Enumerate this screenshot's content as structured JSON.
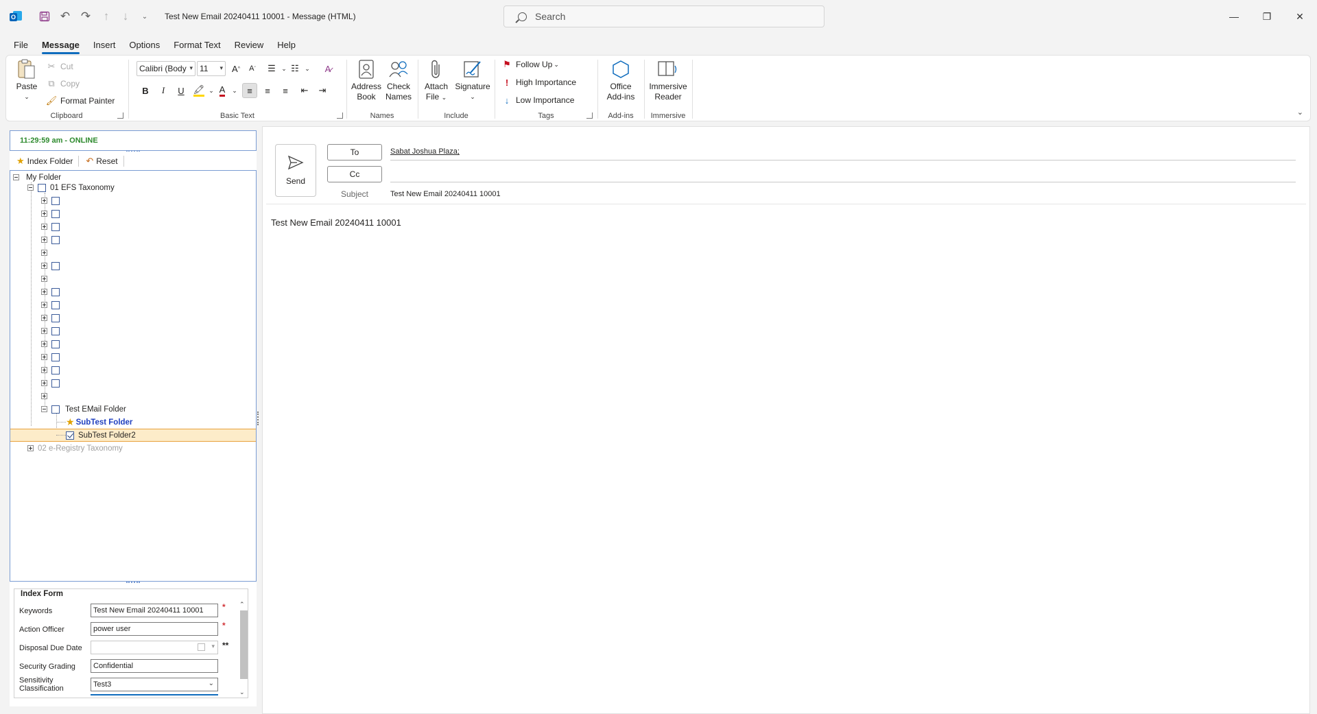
{
  "window": {
    "title": "Test New Email  20240411 10001  -  Message (HTML)",
    "search_placeholder": "Search"
  },
  "menu": {
    "tabs": [
      "File",
      "Message",
      "Insert",
      "Options",
      "Format Text",
      "Review",
      "Help"
    ],
    "active": "Message"
  },
  "ribbon": {
    "clipboard": {
      "paste": "Paste",
      "cut": "Cut",
      "copy": "Copy",
      "format_painter": "Format Painter",
      "label": "Clipboard"
    },
    "basic_text": {
      "font": "Calibri (Body",
      "size": "11",
      "label": "Basic Text"
    },
    "names": {
      "address_book_1": "Address",
      "address_book_2": "Book",
      "check_names_1": "Check",
      "check_names_2": "Names",
      "label": "Names"
    },
    "include": {
      "attach_1": "Attach",
      "attach_2": "File",
      "signature": "Signature",
      "label": "Include"
    },
    "tags": {
      "follow_up": "Follow Up",
      "high": "High Importance",
      "low": "Low Importance",
      "label": "Tags"
    },
    "addins": {
      "office_1": "Office",
      "office_2": "Add-ins",
      "label": "Add-ins"
    },
    "immersive": {
      "reader_1": "Immersive",
      "reader_2": "Reader",
      "label": "Immersive"
    }
  },
  "left_pane": {
    "status": "11:29:59 am - ONLINE",
    "toolbar": {
      "index_folder": "Index Folder",
      "reset": "Reset"
    },
    "tree": {
      "root": "My Folder",
      "efs": "01 EFS Taxonomy",
      "test_email_folder": "Test EMail Folder",
      "subtest_folder": "SubTest Folder",
      "subtest_folder2": "SubTest Folder2",
      "registry": "02 e-Registry Taxonomy"
    },
    "index_form": {
      "title": "Index Form",
      "keywords_label": "Keywords",
      "keywords_value": "Test New Email  20240411 10001",
      "action_officer_label": "Action Officer",
      "action_officer_value": "power  user",
      "disposal_label": "Disposal Due Date",
      "disposal_value": "",
      "security_label": "Security Grading",
      "security_value": "Confidential",
      "sensitivity_label_1": "Sensitivity",
      "sensitivity_label_2": "Classification",
      "sensitivity_value": "Test3",
      "required_mark": "*",
      "double_mark": "**"
    }
  },
  "message": {
    "send": "Send",
    "to_label": "To",
    "cc_label": "Cc",
    "to_value": "Sabat Joshua Plaza;",
    "subject_label": "Subject",
    "subject_value": "Test New Email  20240411 10001",
    "body": "Test New Email  20240411 10001"
  }
}
